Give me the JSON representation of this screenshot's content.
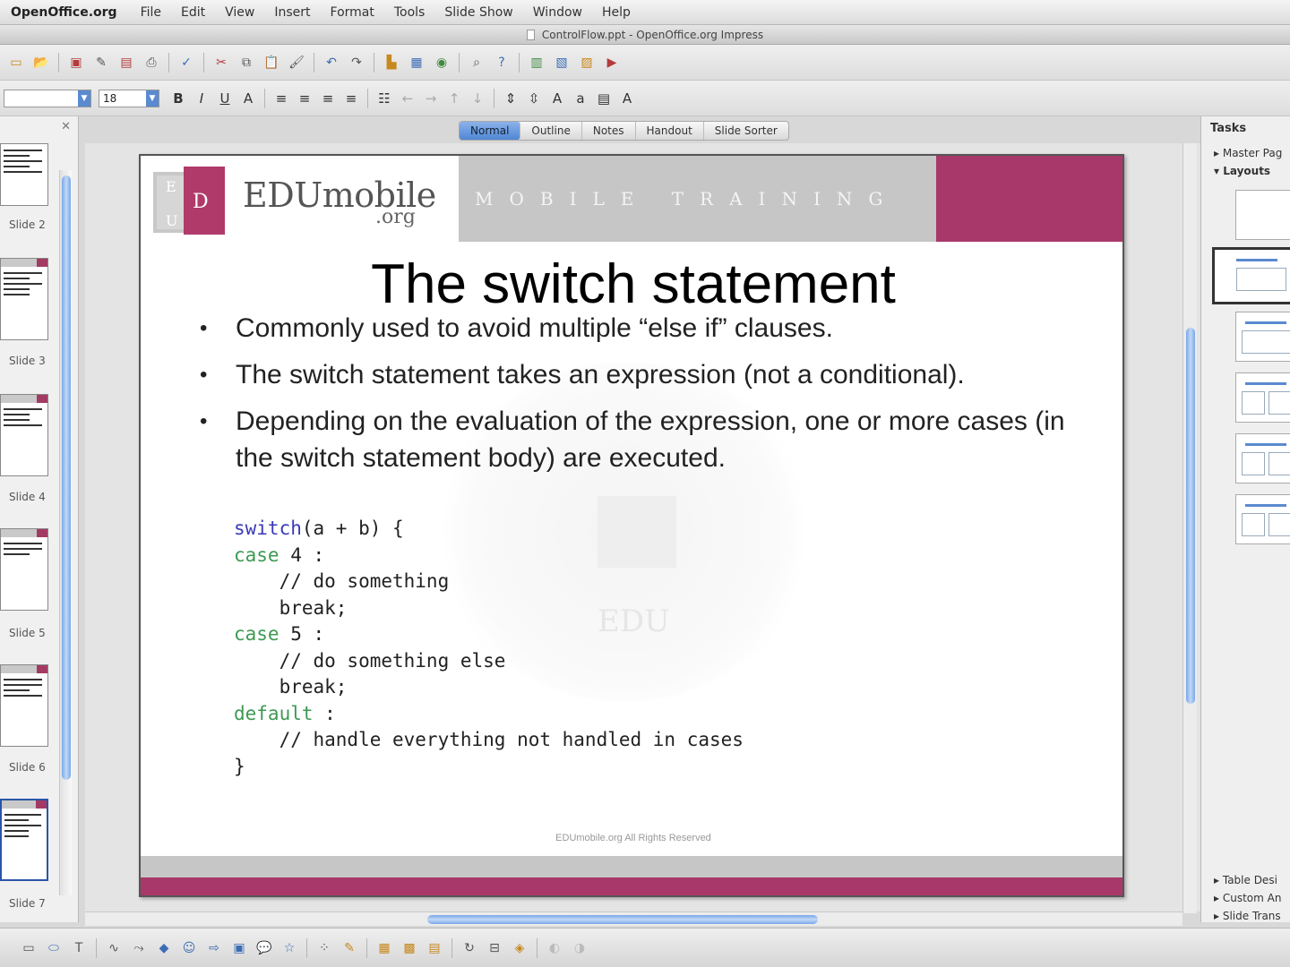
{
  "menubar": {
    "app": "OpenOffice.org",
    "items": [
      "File",
      "Edit",
      "View",
      "Insert",
      "Format",
      "Tools",
      "Slide Show",
      "Window",
      "Help"
    ]
  },
  "window": {
    "title": "ControlFlow.ppt - OpenOffice.org Impress"
  },
  "format_toolbar": {
    "font_size": "18"
  },
  "view_tabs": {
    "items": [
      "Normal",
      "Outline",
      "Notes",
      "Handout",
      "Slide Sorter"
    ],
    "active": "Normal"
  },
  "slides_pane": {
    "labels": [
      "Slide 2",
      "Slide 3",
      "Slide 4",
      "Slide 5",
      "Slide 6",
      "Slide 7"
    ],
    "selected": "Slide 7"
  },
  "slide": {
    "logo_text": "EDUmobile",
    "logo_org": ".org",
    "logo_letters": "EDU",
    "banner_text": "MOBILE TRAINING",
    "title": "The switch statement",
    "bullets": [
      "Commonly used to avoid multiple “else if” clauses.",
      "The switch statement takes an expression (not a conditional).",
      "Depending on the evaluation of the expression, one or more cases (in the switch statement body) are executed."
    ],
    "code": {
      "l1_kw": "switch",
      "l1_rest": "(a + b) {",
      "l2_kw": "case",
      "l2_rest": " 4 :",
      "l3": "    // do something",
      "l4": "    break;",
      "l5_kw": "case",
      "l5_rest": " 5 :",
      "l6": "    // do something else",
      "l7": "    break;",
      "l8_kw": "default",
      "l8_rest": " :",
      "l9": "    // handle everything not handled in cases",
      "l10": "}"
    },
    "footer": "EDUmobile.org All Rights Reserved",
    "watermark_text": "EDU",
    "colors": {
      "accent": "#a8386a",
      "band": "#c6c6c6",
      "keyword": "#3a3ab8",
      "case_keyword": "#3d9a52"
    }
  },
  "tasks_pane": {
    "title": "Tasks",
    "sections_top": [
      "Master Pag",
      "Layouts"
    ],
    "sections_bottom": [
      "Table Desi",
      "Custom An",
      "Slide Trans"
    ]
  },
  "icons": {
    "toolbar1": [
      "new-icon",
      "open-icon",
      "save-icon",
      "edit-file-icon",
      "export-pdf-icon",
      "print-icon",
      "spellcheck-icon",
      "cut-icon",
      "copy-icon",
      "paste-icon",
      "format-paintbrush-icon",
      "undo-icon",
      "redo-icon",
      "chart-icon",
      "table-icon",
      "navigator-icon",
      "zoom-icon",
      "help-icon"
    ],
    "drawing": [
      "select-icon",
      "line-icon",
      "rectangle-icon",
      "ellipse-icon",
      "text-icon",
      "curve-icon",
      "connector-icon",
      "basic-shapes-icon",
      "symbol-shapes-icon",
      "block-arrows-icon",
      "flowchart-icon",
      "callouts-icon",
      "stars-icon",
      "points-icon",
      "glue-points-icon",
      "fontwork-icon",
      "from-file-icon",
      "gallery-icon",
      "rotate-icon",
      "alignment-icon",
      "arrange-icon",
      "extrusion-icon"
    ]
  }
}
